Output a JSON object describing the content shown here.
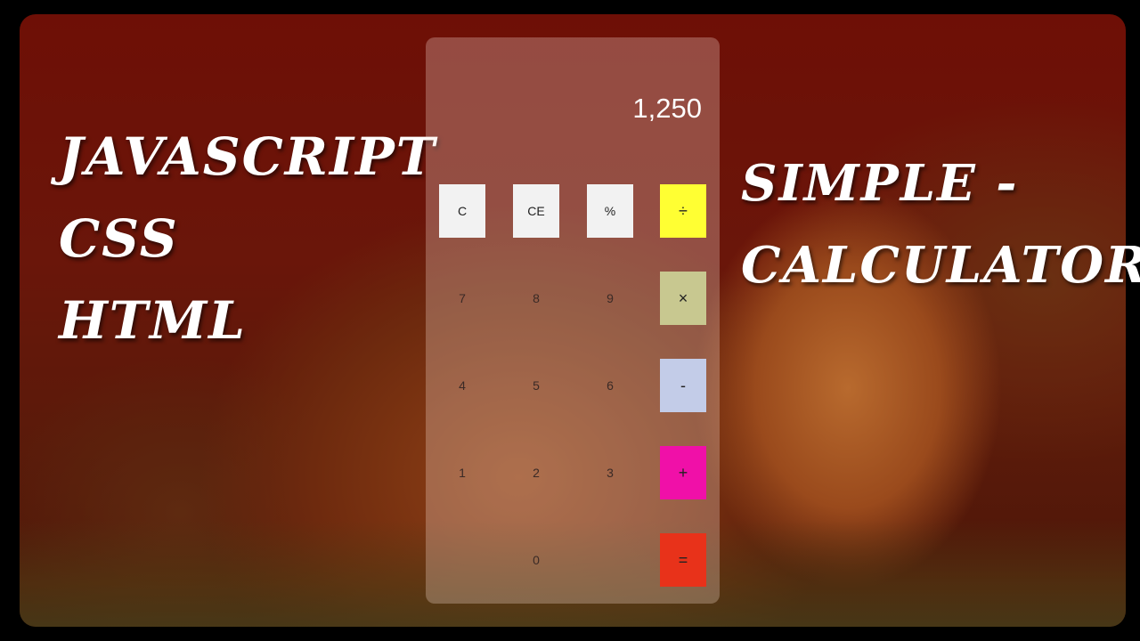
{
  "left_text": [
    "JAVASCRIPT",
    "CSS",
    "HTML"
  ],
  "right_text": [
    "SIMPLE -",
    "CALCULATOR"
  ],
  "calculator": {
    "display": "1,250",
    "buttons": {
      "clear": "C",
      "clear_entry": "CE",
      "percent": "%",
      "divide": "÷",
      "seven": "7",
      "eight": "8",
      "nine": "9",
      "multiply": "×",
      "four": "4",
      "five": "5",
      "six": "6",
      "subtract": "-",
      "one": "1",
      "two": "2",
      "three": "3",
      "add": "+",
      "zero": "0",
      "equals": "="
    },
    "colors": {
      "divide": "#ffff33",
      "multiply": "#c8c890",
      "subtract": "#c3cce8",
      "add": "#f010a8",
      "equals": "#e8321a"
    }
  }
}
